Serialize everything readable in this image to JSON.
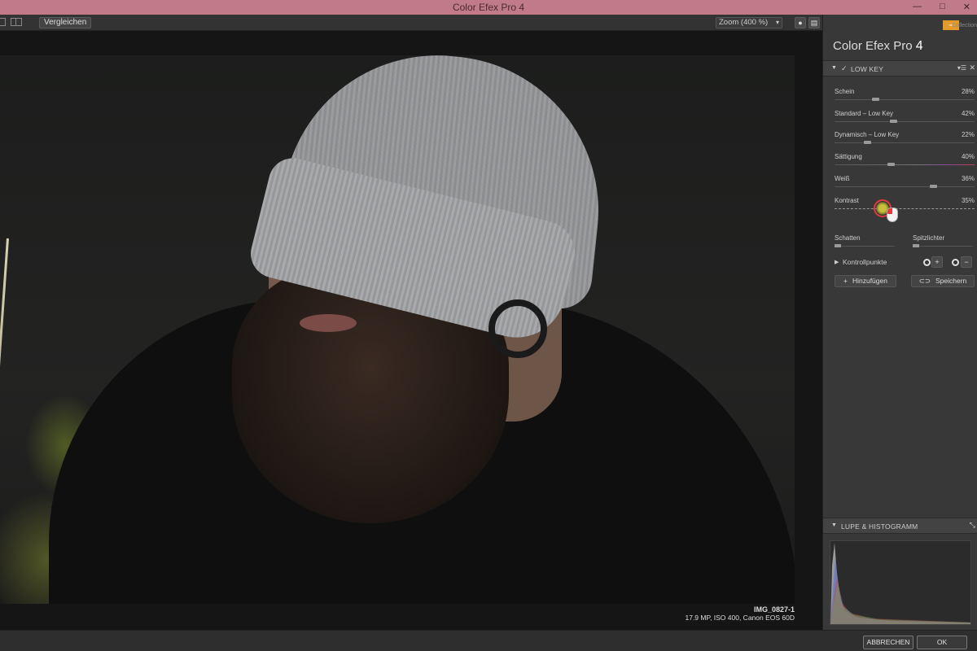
{
  "window": {
    "title": "Color Efex Pro 4",
    "controls": [
      "—",
      "□",
      "✕"
    ]
  },
  "toolbar": {
    "compare_label": "Vergleichen",
    "zoom_label": "Zoom (400 %)",
    "zoom_chevron": "▾"
  },
  "image_meta": {
    "filename": "IMG_0827-1",
    "details": "17.9 MP, ISO 400, Canon EOS 60D"
  },
  "panel": {
    "title_text": "Color Efex Pro",
    "title_version": "4",
    "brand_badge": "nik",
    "brand_text": "Collection"
  },
  "filter": {
    "name": "LOW KEY",
    "enabled_check": "✓",
    "sliders": [
      {
        "label": "Schein",
        "value": "28%",
        "fraction": 0.28
      },
      {
        "label": "Standard – Low Key",
        "value": "42%",
        "fraction": 0.42
      },
      {
        "label": "Dynamisch – Low Key",
        "value": "22%",
        "fraction": 0.22
      },
      {
        "label": "Sättigung",
        "value": "40%",
        "fraction": 0.4
      },
      {
        "label": "Weiß",
        "value": "36%",
        "fraction": 0.72
      },
      {
        "label": "Kontrast",
        "value": "35%",
        "fraction": 0.35
      }
    ],
    "schatten_label": "Schatten",
    "spitzlichter_label": "Spitzlichter",
    "control_points_label": "Kontrollpunkte",
    "add_label": "Hinzufügen",
    "save_label": "Speichern"
  },
  "loupe": {
    "title": "LUPE & HISTOGRAMM"
  },
  "footer": {
    "cancel_label": "ABBRECHEN",
    "ok_label": "OK"
  },
  "colors": {
    "titlebar": "#c07a88",
    "accent_red": "#e23a3a",
    "brand_orange": "#e39a2a"
  }
}
